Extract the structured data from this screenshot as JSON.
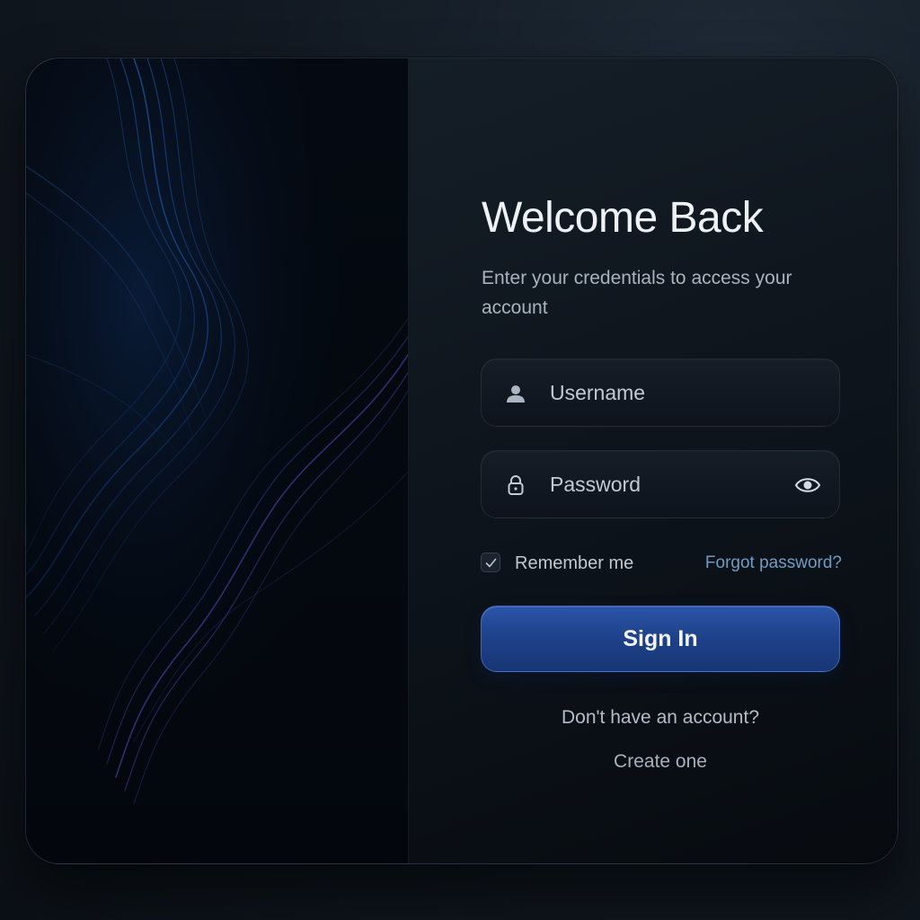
{
  "login": {
    "title": "Welcome Back",
    "subtitle": "Enter your credentials to access your account",
    "username": {
      "value": "",
      "placeholder": "Username",
      "icon": "user-icon"
    },
    "password": {
      "value": "",
      "placeholder": "Password",
      "icon": "lock-icon",
      "toggle_icon": "eye-icon"
    },
    "remember": {
      "label": "Remember me",
      "checked": true
    },
    "forgot_label": "Forgot password?",
    "submit_label": "Sign In",
    "no_account_text": "Don't have an account?",
    "create_label": "Create one"
  },
  "colors": {
    "accent": "#2a55a8",
    "link": "#6f9cc4",
    "background": "#0b1016",
    "text_primary": "#eef2f6"
  }
}
